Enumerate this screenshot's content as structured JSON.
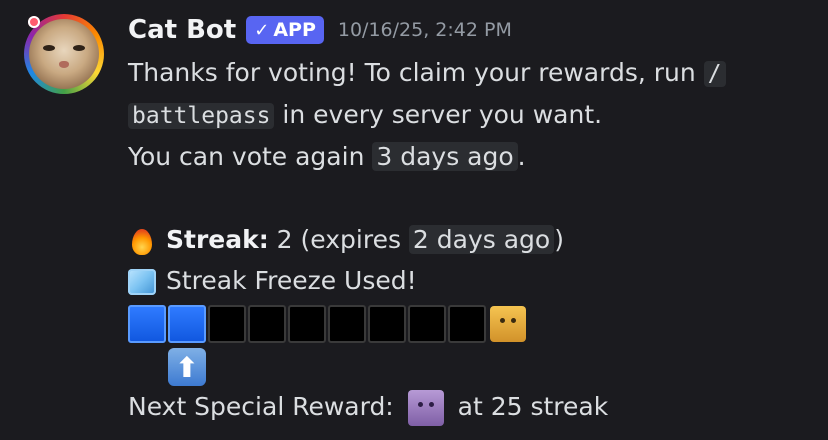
{
  "message": {
    "author": "Cat Bot",
    "badge": "APP",
    "badge_check": "✓",
    "timestamp": "10/16/25, 2:42 PM",
    "line1_text": "Thanks for voting! To claim your rewards, run ",
    "line1_code": "/",
    "line2_code": "battlepass",
    "line2_text": " in every server you want.",
    "line3_text": "You can vote again ",
    "line3_time": "3 days ago",
    "line3_end": ".",
    "streak_label": "Streak:",
    "streak_text": " 2 (expires ",
    "streak_time": "2 days ago",
    "streak_end": ")",
    "freeze_text": "Streak Freeze Used!",
    "arrow_glyph": "⬆",
    "next_reward_label": "Next Special Reward: ",
    "next_reward_text": " at 25 streak"
  },
  "progress": {
    "filled_segments": 2,
    "total_segments": 9
  },
  "icons": {
    "streak": "fire-icon",
    "freeze": "ice-cube-icon",
    "reward_box": "gold-cat-box-icon",
    "special_reward": "purple-cat-box-icon",
    "pointer": "up-arrow-icon"
  },
  "colors": {
    "background": "#1b1b1f",
    "badge": "#5865f2",
    "segment_filled": "#1f6bff",
    "segment_empty": "#000000"
  }
}
